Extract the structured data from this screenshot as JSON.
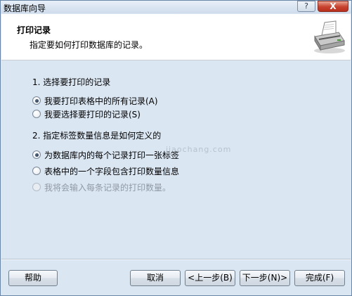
{
  "window": {
    "title": "数据库向导",
    "help_button": "?",
    "close_button": "X"
  },
  "header": {
    "title": "打印记录",
    "subtitle": "指定要如何打印数据库的记录。"
  },
  "section1": {
    "title": "1. 选择要打印的记录",
    "options": [
      {
        "label": "我要打印表格中的所有记录(A)",
        "checked": true,
        "enabled": true
      },
      {
        "label": "我要选择要打印的记录(S)",
        "checked": false,
        "enabled": true
      }
    ]
  },
  "section2": {
    "title": "2. 指定标签数量信息是如何定义的",
    "options": [
      {
        "label": "为数据库内的每个记录打印一张标签",
        "checked": true,
        "enabled": true
      },
      {
        "label": "表格中的一个字段包含打印数量信息",
        "checked": false,
        "enabled": true
      },
      {
        "label": "我将会输入每条记录的打印数量。",
        "checked": false,
        "enabled": false
      }
    ]
  },
  "watermark": "jiaochang.com",
  "buttons": {
    "help": "帮助",
    "cancel": "取消",
    "back": "<上一步(B)",
    "next": "下一步(N)>",
    "finish": "完成(F)"
  }
}
